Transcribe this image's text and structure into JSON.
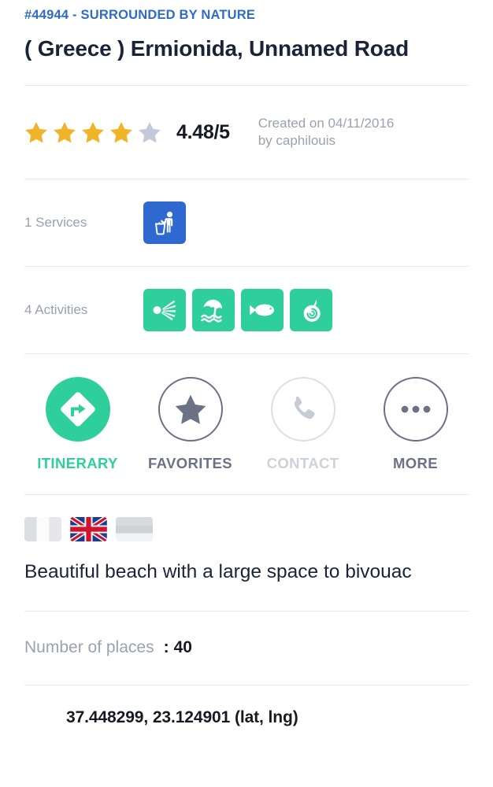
{
  "header": {
    "reference": "#44944 - SURROUNDED BY NATURE",
    "title": "( Greece ) Ermionida, Unnamed Road"
  },
  "rating": {
    "score_text": "4.48/5",
    "score_value": 4.48,
    "max": 5,
    "stars_filled": 4,
    "stars_total": 5,
    "created_text": "Created on 04/11/2016 by caphilouis",
    "star_filled_color": "#f0b429",
    "star_empty_color": "#c3c9da"
  },
  "services": {
    "label": "1 Services",
    "count": 1,
    "tile_color": "#2f69d0",
    "items": [
      {
        "icon": "litter-disposal-icon",
        "name": "Trash"
      }
    ]
  },
  "activities": {
    "label": "4 Activities",
    "count": 4,
    "tile_color": "#2ecf9b",
    "items": [
      {
        "icon": "scallop-shell-icon",
        "name": "Shellfish gathering"
      },
      {
        "icon": "beach-umbrella-waves-icon",
        "name": "Beach"
      },
      {
        "icon": "fish-icon",
        "name": "Fishing"
      },
      {
        "icon": "spiral-shell-icon",
        "name": "Shell collecting"
      }
    ]
  },
  "actions": [
    {
      "key": "itinerary",
      "label": "ITINERARY",
      "icon": "turn-right-diamond-icon",
      "state": "primary"
    },
    {
      "key": "favorites",
      "label": "FAVORITES",
      "icon": "star-icon",
      "state": "default"
    },
    {
      "key": "contact",
      "label": "CONTACT",
      "icon": "phone-icon",
      "state": "disabled"
    },
    {
      "key": "more",
      "label": "MORE",
      "icon": "ellipsis-icon",
      "state": "default"
    }
  ],
  "languages": [
    {
      "code": "fr",
      "name": "French",
      "active": false
    },
    {
      "code": "gb",
      "name": "English",
      "active": true
    },
    {
      "code": "de",
      "name": "German",
      "active": false
    }
  ],
  "description": "Beautiful beach with a large space to bivouac",
  "places": {
    "label": "Number of places",
    "separator": ":",
    "value": "40"
  },
  "coordinates": {
    "text": "37.448299, 23.124901 (lat, lng)",
    "lat": 37.448299,
    "lng": 23.124901
  },
  "colors": {
    "accent_green": "#2ecf9b",
    "accent_blue": "#2f6cc4",
    "service_blue": "#2f69d0",
    "text_dark": "#1b2338",
    "text_muted": "#9aa1b1",
    "divider": "#e7e9ed"
  }
}
